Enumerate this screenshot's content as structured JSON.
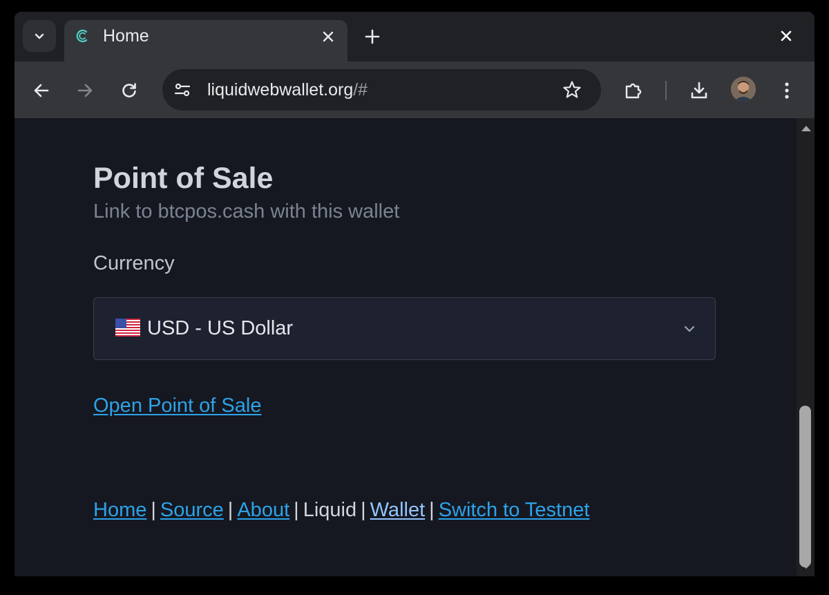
{
  "browser": {
    "tab": {
      "title": "Home"
    },
    "address_bar": {
      "url_main": "liquidwebwallet.org",
      "url_suffix": "/#"
    }
  },
  "page": {
    "title": "Point of Sale",
    "subtitle": "Link to btcpos.cash with this wallet",
    "currency": {
      "label": "Currency",
      "flag": "🇺🇸",
      "selected": "USD - US Dollar"
    },
    "open_link": "Open Point of Sale",
    "footer": {
      "home": "Home",
      "source": "Source",
      "about": "About",
      "network": "Liquid",
      "wallet": "Wallet",
      "switch": "Switch to Testnet",
      "separator": "|"
    }
  },
  "colors": {
    "page_bg": "#151821",
    "link": "#2da3e8",
    "current_link": "#93c5fd",
    "title": "#d1d5db"
  },
  "icons": {
    "tab_search": "chevron-down-icon",
    "favicon": "liquid-logo-icon",
    "tab_close": "close-icon",
    "new_tab": "plus-icon",
    "window_close": "close-icon",
    "back": "arrow-left-icon",
    "forward": "arrow-right-icon",
    "reload": "reload-icon",
    "site_info": "tune-icon",
    "bookmark": "star-icon",
    "extensions": "puzzle-icon",
    "downloads": "download-icon",
    "menu": "kebab-menu-icon",
    "select_chevron": "chevron-down-icon"
  }
}
